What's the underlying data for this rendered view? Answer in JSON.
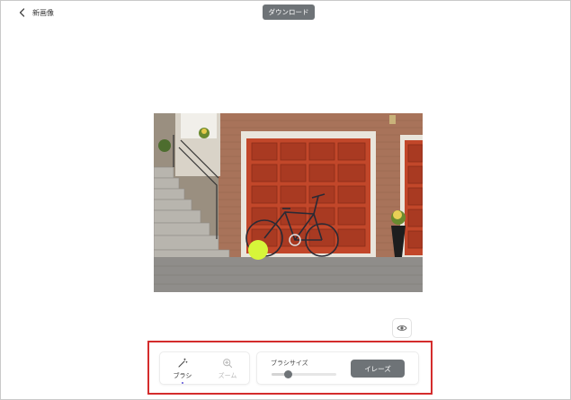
{
  "header": {
    "back_label": "新画像",
    "download_label": "ダウンロード"
  },
  "canvas": {
    "brush_cursor_color": "#d7f53a"
  },
  "toolbar": {
    "tools": [
      {
        "id": "brush",
        "label": "ブラシ",
        "icon": "magic-wand-icon",
        "active": true
      },
      {
        "id": "zoom",
        "label": "ズーム",
        "icon": "zoom-in-icon",
        "active": false
      }
    ],
    "brush_size_label": "ブラシサイズ",
    "brush_size_fraction": 0.25,
    "erase_label": "イレーズ",
    "accent_color": "#d42c2c",
    "button_color": "#6e7377"
  }
}
